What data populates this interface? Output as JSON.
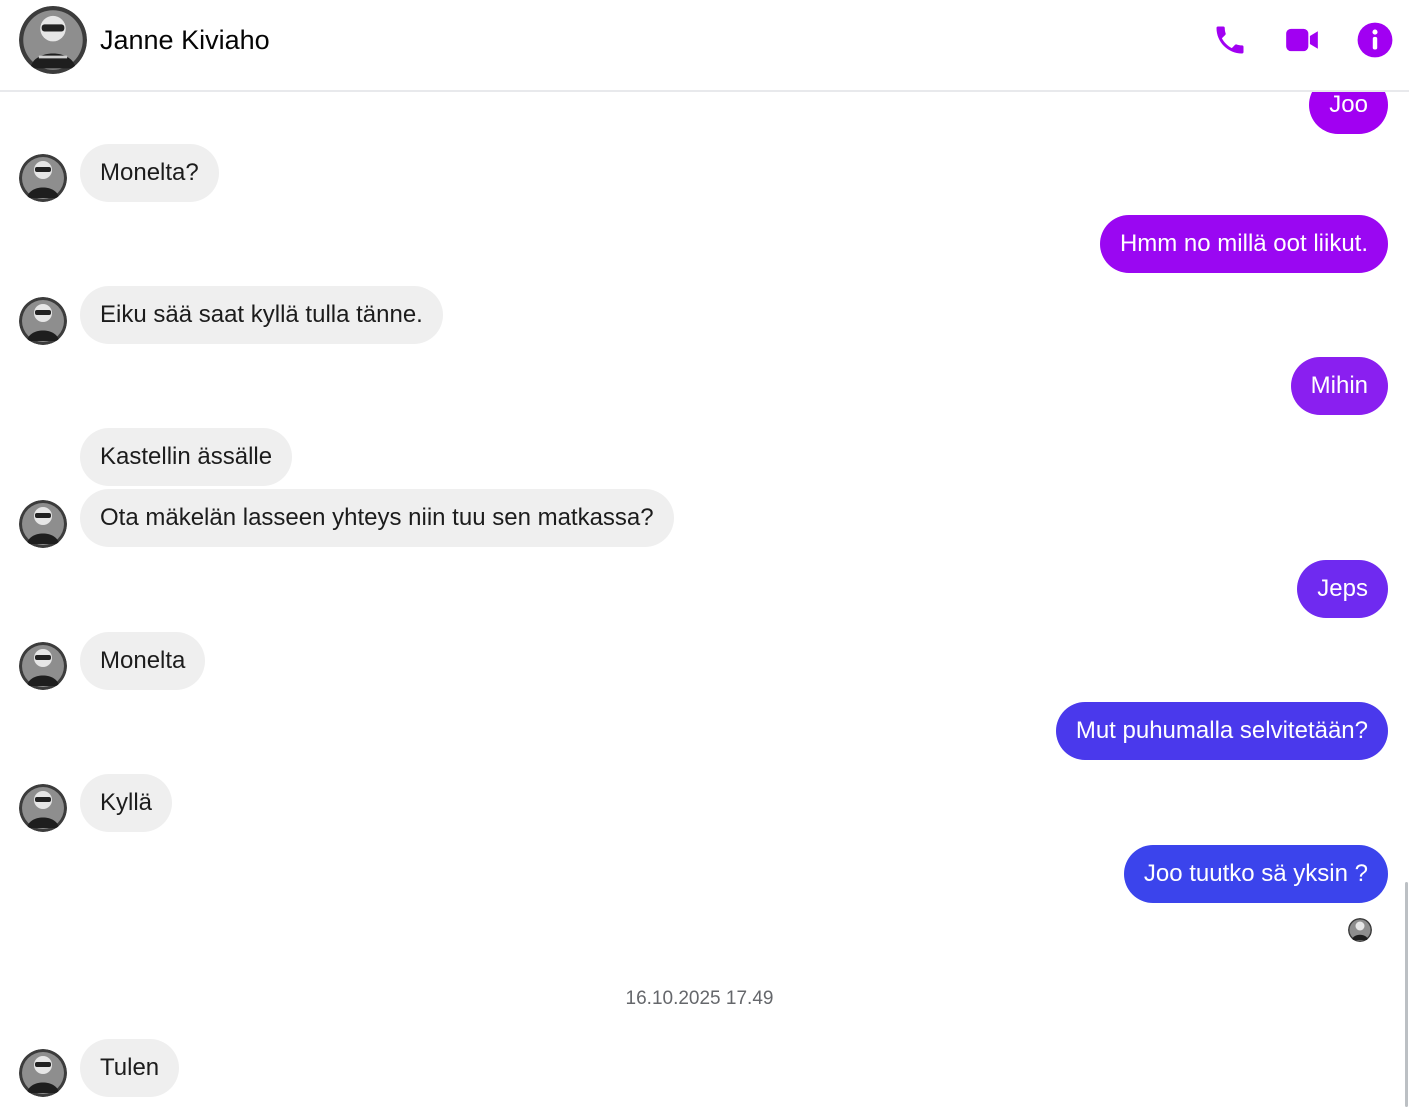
{
  "header": {
    "contact_name": "Janne Kiviaho",
    "icons": {
      "phone": "phone-icon",
      "video": "video-camera-icon",
      "info": "info-icon"
    },
    "accent_color": "#a100f2"
  },
  "messages": [
    {
      "sender": "me",
      "text": "Joo"
    },
    {
      "sender": "contact",
      "text": "Monelta?"
    },
    {
      "sender": "me",
      "text": "Hmm no millä oot liikut."
    },
    {
      "sender": "contact",
      "text": "Eiku sää saat kyllä tulla tänne."
    },
    {
      "sender": "me",
      "text": "Mihin"
    },
    {
      "sender": "contact",
      "text": "Kastellin ässälle"
    },
    {
      "sender": "contact",
      "text": "Ota mäkelän lasseen yhteys niin tuu sen matkassa?"
    },
    {
      "sender": "me",
      "text": "Jeps"
    },
    {
      "sender": "contact",
      "text": "Monelta"
    },
    {
      "sender": "me",
      "text": "Mut puhumalla selvitetään?"
    },
    {
      "sender": "contact",
      "text": "Kyllä"
    },
    {
      "sender": "me",
      "text": "Joo tuutko sä yksin ?"
    },
    {
      "sender": "contact",
      "text": "Tulen"
    }
  ],
  "timestamp": "16.10.2025 17.49",
  "colors": {
    "incoming_bubble": "#efefef",
    "outgoing_gradient": [
      "#a100f2",
      "#8a1ff0",
      "#6f2af0",
      "#5a32ee",
      "#4a39ec",
      "#3f40ec",
      "#3b44ec"
    ]
  }
}
